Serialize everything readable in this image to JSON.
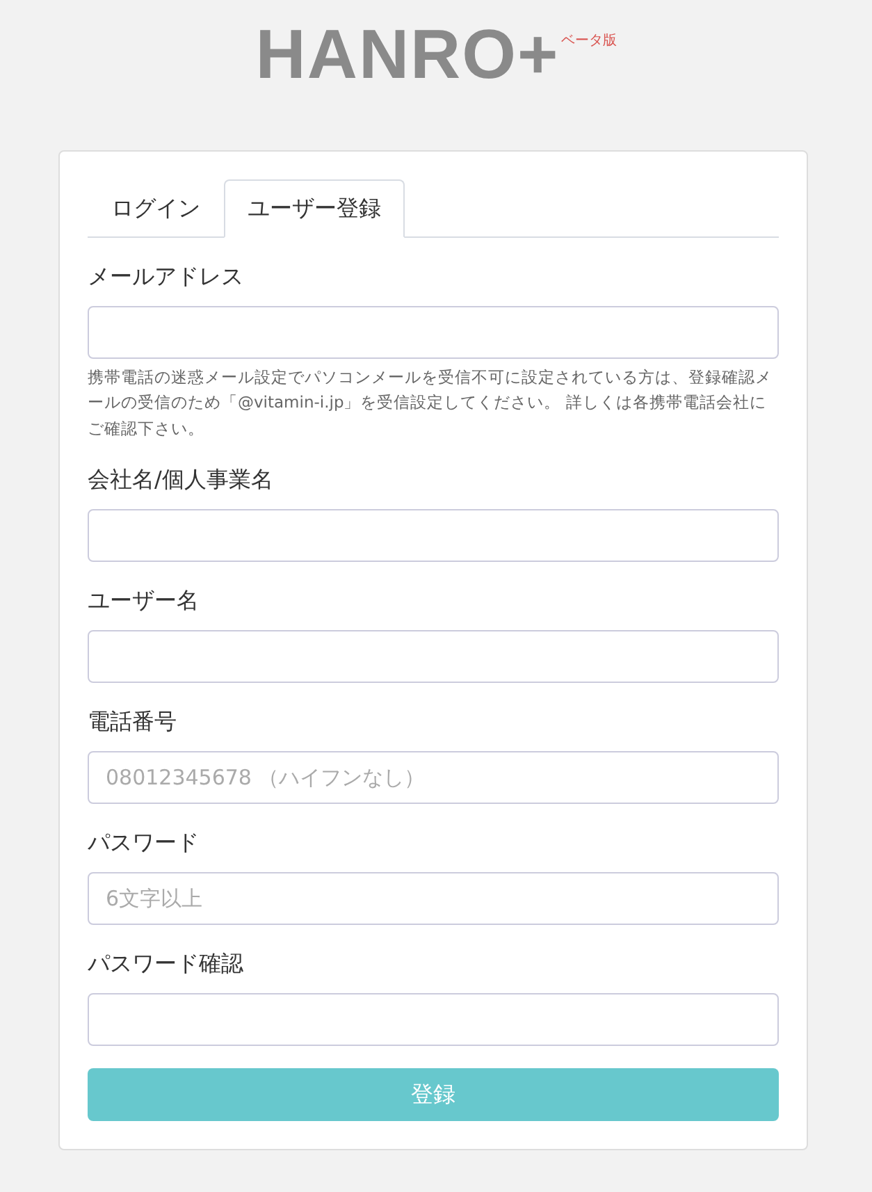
{
  "logo": {
    "text": "HANRO+",
    "badge": "ベータ版"
  },
  "tabs": [
    {
      "label": "ログイン",
      "selected": false
    },
    {
      "label": "ユーザー登録",
      "selected": true
    }
  ],
  "fields": [
    {
      "label": "メールアドレス",
      "help": "携帯電話の迷惑メール設定でパソコンメールを受信不可に設定されている方は、登録確認メールの受信のため「@vitamin-i.jp」を受信設定してください。 詳しくは各携帯電話会社にご確認下さい。"
    },
    {
      "label": "会社名/個人事業名"
    },
    {
      "label": "ユーザー名"
    },
    {
      "label": "電話番号",
      "placeholder": "08012345678 （ハイフンなし）"
    },
    {
      "label": "パスワード",
      "placeholder": "6文字以上"
    },
    {
      "label": "パスワード確認"
    }
  ],
  "submit": {
    "label": "登録",
    "disabled": true
  }
}
